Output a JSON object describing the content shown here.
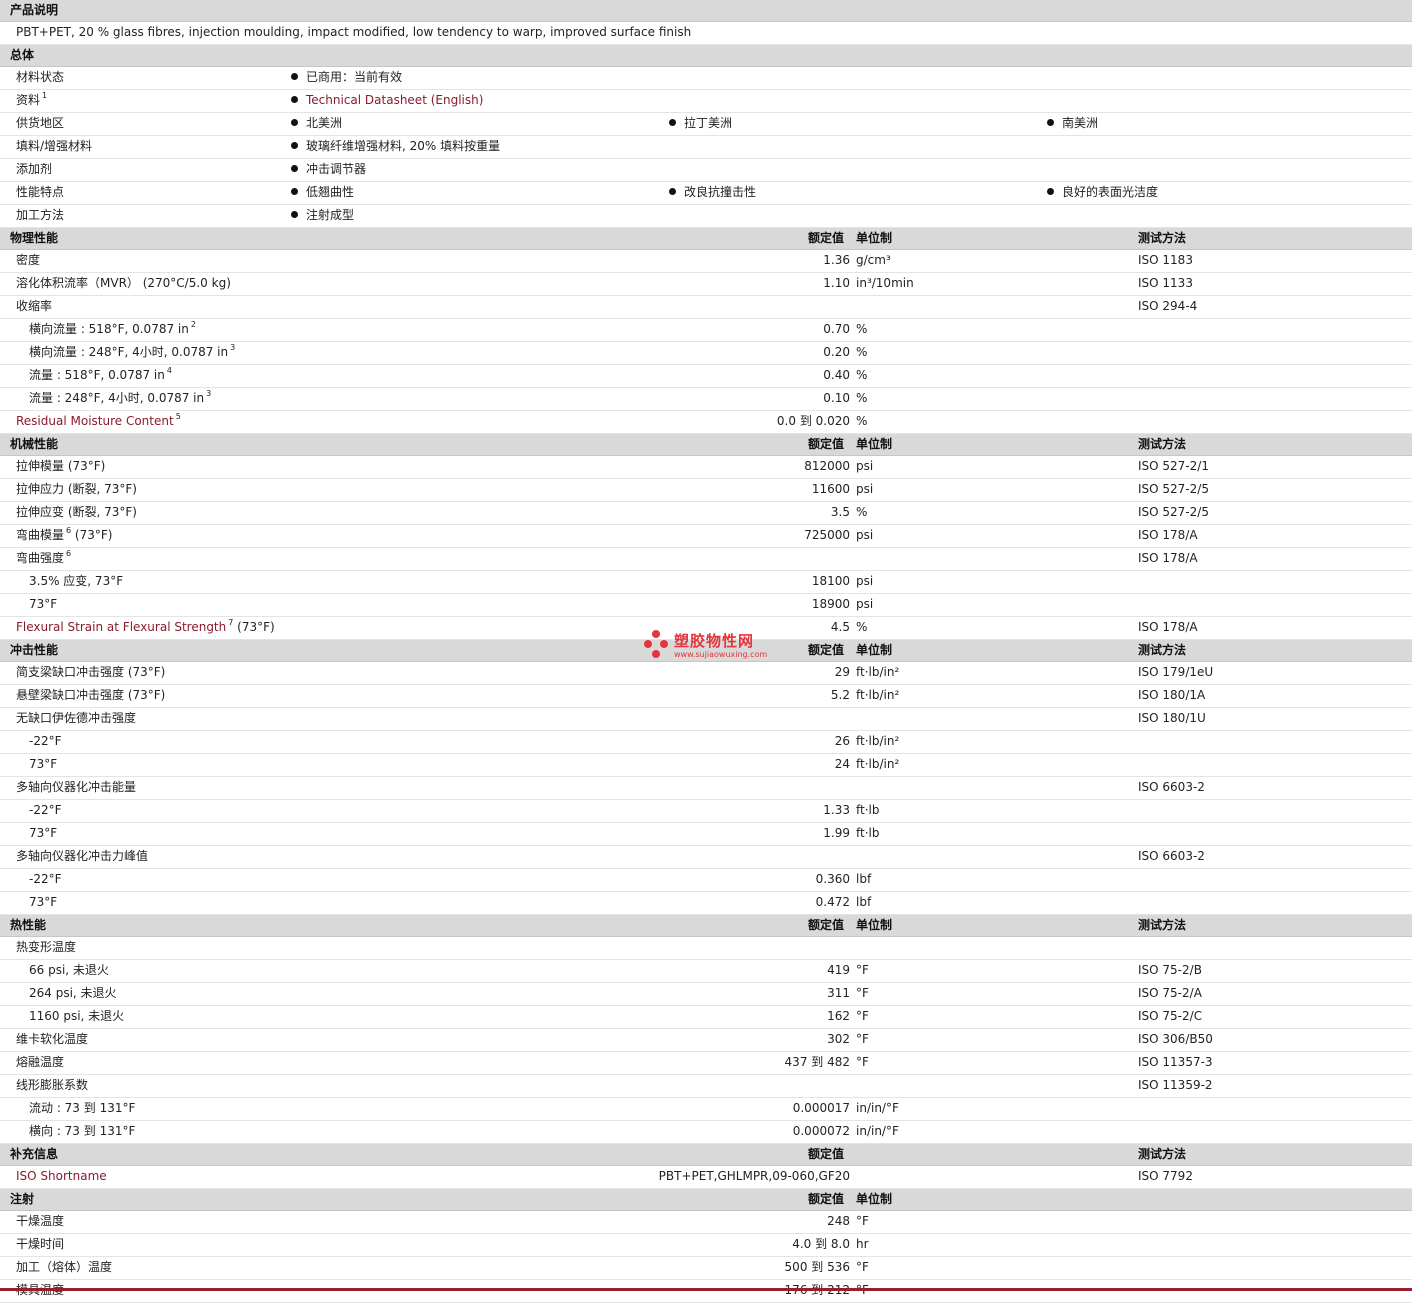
{
  "description": {
    "title": "产品说明",
    "text": "PBT+PET, 20 % glass fibres, injection moulding, impact modified, low tendency to warp, improved surface finish"
  },
  "general": {
    "title": "总体",
    "rows": [
      {
        "label": "材料状态",
        "items": [
          "已商用：当前有效"
        ]
      },
      {
        "label": "资料",
        "sup": "1",
        "items": [
          "Technical Datasheet (English)"
        ],
        "link": true
      },
      {
        "label": "供货地区",
        "items": [
          "北美洲",
          "拉丁美洲",
          "南美洲"
        ]
      },
      {
        "label": "填料/增强材料",
        "items": [
          "玻璃纤维增强材料, 20% 填料按重量"
        ]
      },
      {
        "label": "添加剂",
        "items": [
          "冲击调节器"
        ]
      },
      {
        "label": "性能特点",
        "items": [
          "低翘曲性",
          "改良抗撞击性",
          "良好的表面光洁度"
        ]
      },
      {
        "label": "加工方法",
        "items": [
          "注射成型"
        ]
      }
    ]
  },
  "sections": [
    {
      "title": "物理性能",
      "h_val": "额定值",
      "h_unit": "单位制",
      "h_test": "测试方法",
      "rows": [
        {
          "label": "密度",
          "value": "1.36",
          "unit": "g/cm³",
          "test": "ISO 1183"
        },
        {
          "label": "溶化体积流率（MVR） (270°C/5.0 kg)",
          "value": "1.10",
          "unit": "in³/10min",
          "test": "ISO 1133"
        },
        {
          "label": "收缩率",
          "value": "",
          "unit": "",
          "test": "ISO 294-4"
        },
        {
          "label": "横向流量 : 518°F, 0.0787 in",
          "sup": "2",
          "sub": true,
          "value": "0.70",
          "unit": "%",
          "test": ""
        },
        {
          "label": "横向流量 : 248°F, 4小时, 0.0787 in",
          "sup": "3",
          "sub": true,
          "value": "0.20",
          "unit": "%",
          "test": ""
        },
        {
          "label": "流量 : 518°F, 0.0787 in",
          "sup": "4",
          "sub": true,
          "value": "0.40",
          "unit": "%",
          "test": ""
        },
        {
          "label": "流量 : 248°F, 4小时, 0.0787 in",
          "sup": "3",
          "sub": true,
          "value": "0.10",
          "unit": "%",
          "test": ""
        },
        {
          "label": "Residual Moisture Content",
          "sup": "5",
          "link": true,
          "value": "0.0 到 0.020",
          "unit": "%",
          "test": ""
        }
      ]
    },
    {
      "title": "机械性能",
      "h_val": "额定值",
      "h_unit": "单位制",
      "h_test": "测试方法",
      "rows": [
        {
          "label": "拉伸模量 (73°F)",
          "value": "812000",
          "unit": "psi",
          "test": "ISO 527-2/1"
        },
        {
          "label": "拉伸应力 (断裂, 73°F)",
          "value": "11600",
          "unit": "psi",
          "test": "ISO 527-2/5"
        },
        {
          "label": "拉伸应变 (断裂, 73°F)",
          "value": "3.5",
          "unit": "%",
          "test": "ISO 527-2/5"
        },
        {
          "label": "弯曲模量",
          "sup": "6",
          "suffix": " (73°F)",
          "value": "725000",
          "unit": "psi",
          "test": "ISO 178/A"
        },
        {
          "label": "弯曲强度",
          "sup": "6",
          "value": "",
          "unit": "",
          "test": "ISO 178/A"
        },
        {
          "label": "3.5% 应变, 73°F",
          "sub": true,
          "value": "18100",
          "unit": "psi",
          "test": ""
        },
        {
          "label": "73°F",
          "sub": true,
          "value": "18900",
          "unit": "psi",
          "test": ""
        },
        {
          "label": "Flexural Strain at Flexural Strength",
          "sup": "7",
          "suffix": " (73°F)",
          "link": true,
          "value": "4.5",
          "unit": "%",
          "test": "ISO 178/A"
        }
      ]
    },
    {
      "title": "冲击性能",
      "h_val": "额定值",
      "h_unit": "单位制",
      "h_test": "测试方法",
      "rows": [
        {
          "label": "简支梁缺口冲击强度 (73°F)",
          "value": "29",
          "unit": "ft·lb/in²",
          "test": "ISO 179/1eU"
        },
        {
          "label": "悬壁梁缺口冲击强度 (73°F)",
          "value": "5.2",
          "unit": "ft·lb/in²",
          "test": "ISO 180/1A"
        },
        {
          "label": "无缺口伊佐德冲击强度",
          "value": "",
          "unit": "",
          "test": "ISO 180/1U"
        },
        {
          "label": "-22°F",
          "sub": true,
          "value": "26",
          "unit": "ft·lb/in²",
          "test": ""
        },
        {
          "label": "73°F",
          "sub": true,
          "value": "24",
          "unit": "ft·lb/in²",
          "test": ""
        },
        {
          "label": "多轴向仪器化冲击能量",
          "value": "",
          "unit": "",
          "test": "ISO 6603-2"
        },
        {
          "label": "-22°F",
          "sub": true,
          "value": "1.33",
          "unit": "ft·lb",
          "test": ""
        },
        {
          "label": "73°F",
          "sub": true,
          "value": "1.99",
          "unit": "ft·lb",
          "test": ""
        },
        {
          "label": "多轴向仪器化冲击力峰值",
          "value": "",
          "unit": "",
          "test": "ISO 6603-2"
        },
        {
          "label": "-22°F",
          "sub": true,
          "value": "0.360",
          "unit": "lbf",
          "test": ""
        },
        {
          "label": "73°F",
          "sub": true,
          "value": "0.472",
          "unit": "lbf",
          "test": ""
        }
      ]
    },
    {
      "title": "热性能",
      "h_val": "额定值",
      "h_unit": "单位制",
      "h_test": "测试方法",
      "rows": [
        {
          "label": "热变形温度",
          "value": "",
          "unit": "",
          "test": ""
        },
        {
          "label": "66 psi, 未退火",
          "sub": true,
          "value": "419",
          "unit": "°F",
          "test": "ISO 75-2/B"
        },
        {
          "label": "264 psi, 未退火",
          "sub": true,
          "value": "311",
          "unit": "°F",
          "test": "ISO 75-2/A"
        },
        {
          "label": "1160 psi, 未退火",
          "sub": true,
          "value": "162",
          "unit": "°F",
          "test": "ISO 75-2/C"
        },
        {
          "label": "维卡软化温度",
          "value": "302",
          "unit": "°F",
          "test": "ISO 306/B50"
        },
        {
          "label": "熔融温度",
          "value": "437 到 482",
          "unit": "°F",
          "test": "ISO 11357-3"
        },
        {
          "label": "线形膨胀系数",
          "value": "",
          "unit": "",
          "test": "ISO 11359-2"
        },
        {
          "label": "流动 : 73 到 131°F",
          "sub": true,
          "value": "0.000017",
          "unit": "in/in/°F",
          "test": ""
        },
        {
          "label": "横向 : 73 到 131°F",
          "sub": true,
          "value": "0.000072",
          "unit": "in/in/°F",
          "test": ""
        }
      ]
    },
    {
      "title": "补充信息",
      "h_val": "额定值",
      "h_unit": "",
      "h_test": "测试方法",
      "rows": [
        {
          "label": "ISO Shortname",
          "link": true,
          "value": "PBT+PET,GHLMPR,09-060,GF20",
          "unit": "",
          "test": "ISO 7792"
        }
      ]
    },
    {
      "title": "注射",
      "h_val": "额定值",
      "h_unit": "单位制",
      "h_test": "",
      "rows": [
        {
          "label": "干燥温度",
          "value": "248",
          "unit": "°F",
          "test": ""
        },
        {
          "label": "干燥时间",
          "value": "4.0 到 8.0",
          "unit": "hr",
          "test": ""
        },
        {
          "label": "加工（熔体）温度",
          "value": "500 到 536",
          "unit": "°F",
          "test": ""
        },
        {
          "label": "模具温度",
          "value": "176 到 212",
          "unit": "°F",
          "test": ""
        }
      ]
    }
  ],
  "watermark": {
    "text": "塑胶物性网",
    "url": "www.sujiaowuxing.com"
  },
  "colors": {
    "header_bg": "#d9d9d9",
    "link": "#8a1b2e",
    "watermark": "#e3353d",
    "bottom_rule": "#9b1c2e"
  }
}
